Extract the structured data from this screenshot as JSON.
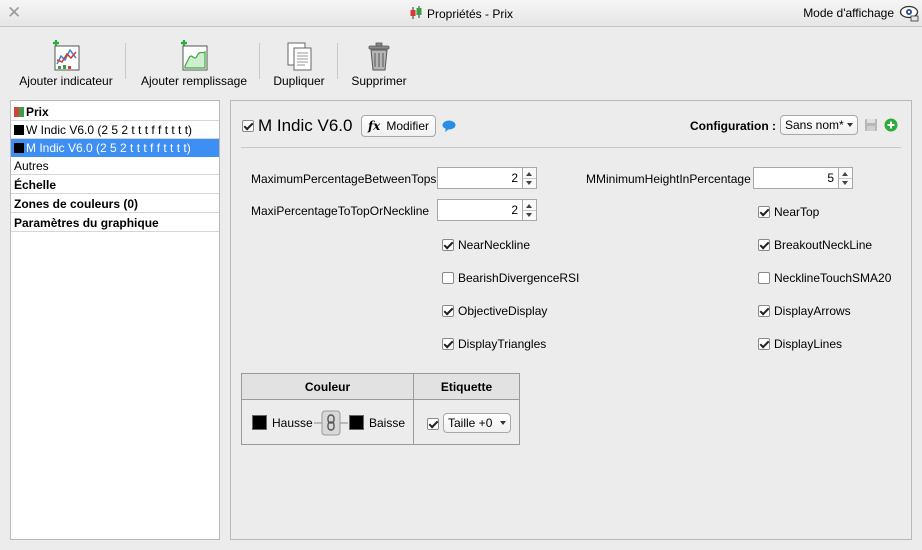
{
  "window": {
    "title": "Propriétés - Prix",
    "mode_label": "Mode d'affichage"
  },
  "toolbar": {
    "add_indicator": "Ajouter indicateur",
    "add_fill": "Ajouter remplissage",
    "duplicate": "Dupliquer",
    "delete": "Supprimer"
  },
  "tree": {
    "items": [
      {
        "label": "Prix",
        "bold": true
      },
      {
        "label": "W Indic V6.0 (2 5 2 t t t f f t t t t)"
      },
      {
        "label": "M Indic V6.0 (2 5 2 t t t f f t t t t)",
        "selected": true
      },
      {
        "label": "Autres"
      },
      {
        "label": "Échelle",
        "bold": true
      },
      {
        "label": "Zones de couleurs (0)",
        "bold": true
      },
      {
        "label": "Paramètres du graphique",
        "bold": true
      }
    ]
  },
  "indicator": {
    "title": "M Indic V6.0",
    "enabled": true,
    "modify_label": "Modifier",
    "configuration_label": "Configuration :",
    "configuration_value": "Sans nom*"
  },
  "params": {
    "max_pct_tops_label": "MaximumPercentageBetweenTops",
    "max_pct_tops_value": "2",
    "min_height_label": "MMinimumHeightInPercentage",
    "min_height_value": "5",
    "maxi_pct_neckline_label": "MaxiPercentageToTopOrNeckline",
    "maxi_pct_neckline_value": "2",
    "near_top": "NearTop",
    "near_neckline": "NearNeckline",
    "breakout_neckline": "BreakoutNeckLine",
    "bearish_div": "BearishDivergenceRSI",
    "neckline_touch": "NecklineTouchSMA20",
    "objective_display": "ObjectiveDisplay",
    "display_arrows": "DisplayArrows",
    "display_triangles": "DisplayTriangles",
    "display_lines": "DisplayLines"
  },
  "checks": {
    "near_top": true,
    "near_neckline": true,
    "breakout_neckline": true,
    "bearish_div": false,
    "neckline_touch": false,
    "objective_display": true,
    "display_arrows": true,
    "display_triangles": true,
    "display_lines": true
  },
  "color_table": {
    "col_color": "Couleur",
    "col_label": "Etiquette",
    "up_label": "Hausse",
    "down_label": "Baisse",
    "size_value": "Taille +0",
    "label_enabled": true,
    "up_color": "#000000",
    "down_color": "#000000"
  },
  "colors": {
    "selection": "#3e8ff3",
    "accent_green": "#2eaa3c",
    "bubble_blue": "#2b8ee6"
  }
}
